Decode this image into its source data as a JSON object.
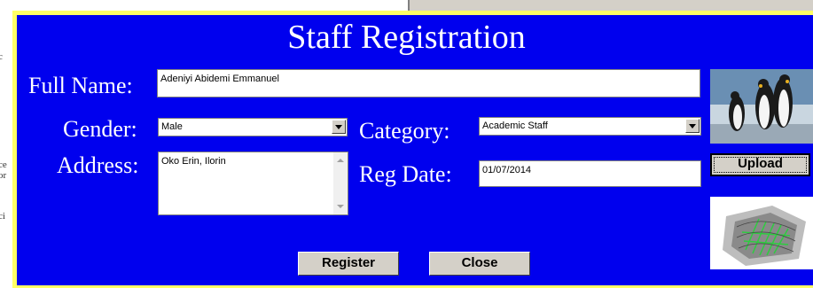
{
  "form": {
    "title": "Staff Registration",
    "full_name_label": "Full Name:",
    "full_name_value": "Adeniyi Abidemi Emmanuel",
    "gender_label": "Gender:",
    "gender_value": "Male",
    "category_label": "Category:",
    "category_value": "Academic Staff",
    "address_label": "Address:",
    "address_value": "Oko Erin, Ilorin",
    "reg_date_label": "Reg Date:",
    "reg_date_value": "01/07/2014",
    "register_button": "Register",
    "close_button": "Close",
    "upload_button": "Upload"
  },
  "background_fragments": [
    "c",
    "ce",
    "or",
    "ci"
  ],
  "colors": {
    "panel": "#0000ee",
    "border": "#ffff66",
    "label_text": "#ffffff",
    "button_face": "#d4d0c8"
  },
  "icons": {
    "photo": "penguins-photo",
    "fingerprint": "fingerprint-image",
    "dropdown": "chevron-down-icon"
  }
}
